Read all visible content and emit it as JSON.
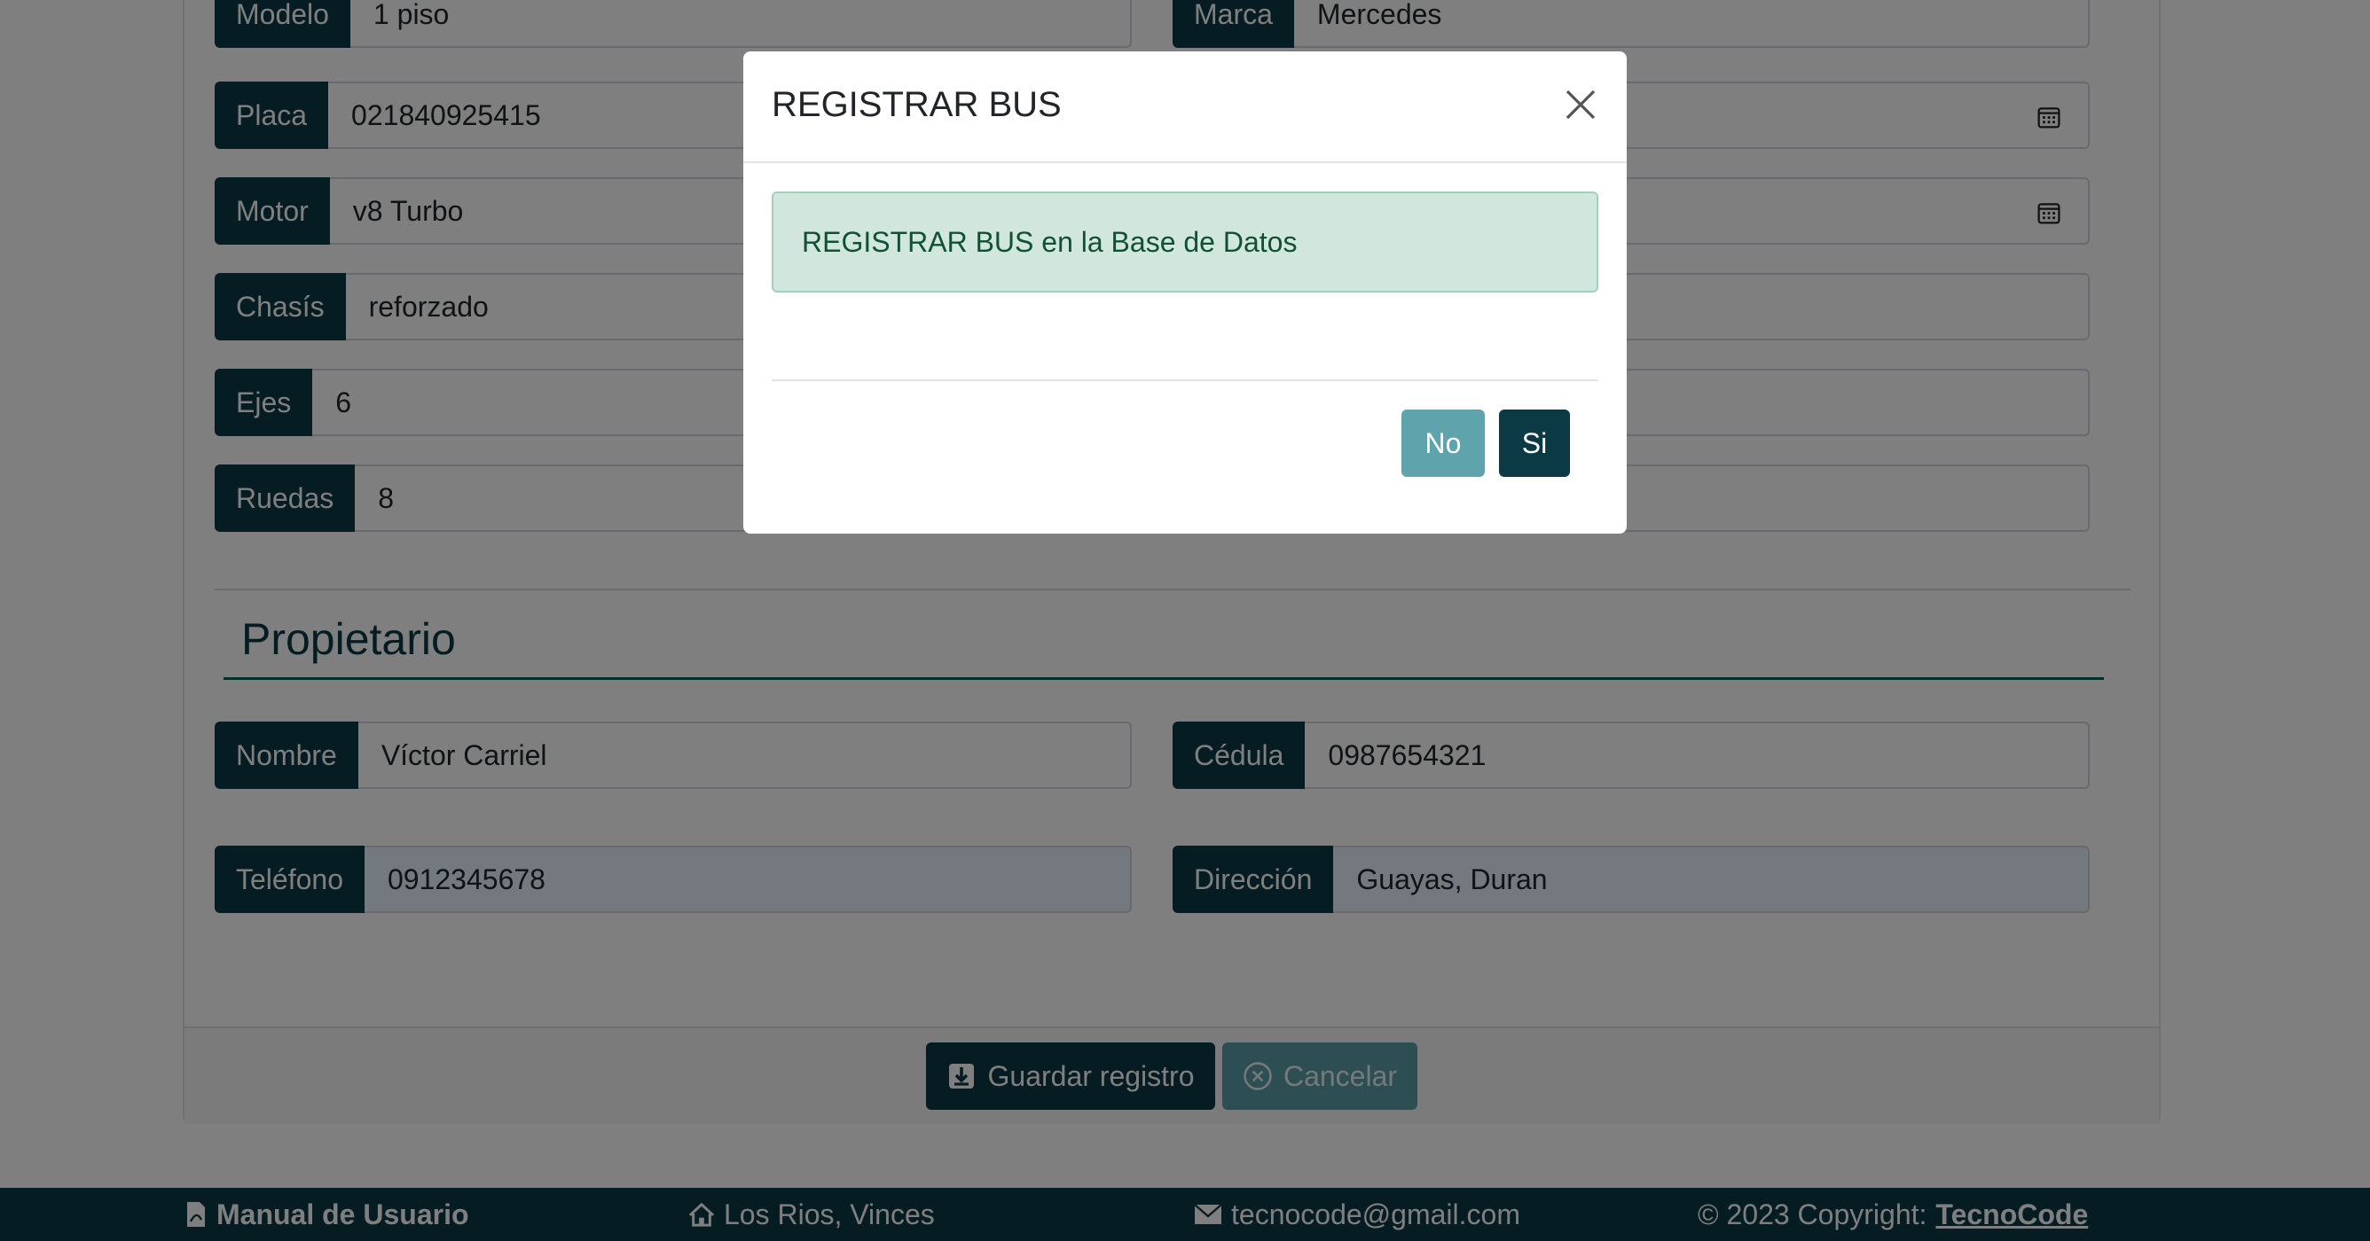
{
  "form": {
    "fields": {
      "modelo": {
        "label": "Modelo",
        "value": "1 piso"
      },
      "marca": {
        "label": "Marca",
        "value": "Mercedes"
      },
      "placa": {
        "label": "Placa",
        "value": "021840925415"
      },
      "motor": {
        "label": "Motor",
        "value": "v8 Turbo"
      },
      "chasis": {
        "label": "Chasís",
        "value": "reforzado"
      },
      "ejes": {
        "label": "Ejes",
        "value": "6"
      },
      "ruedas": {
        "label": "Ruedas",
        "value": "8"
      }
    },
    "owner_section_title": "Propietario",
    "owner": {
      "nombre": {
        "label": "Nombre",
        "value": "Víctor Carriel"
      },
      "cedula": {
        "label": "Cédula",
        "value": "0987654321"
      },
      "telefono": {
        "label": "Teléfono",
        "value": "0912345678"
      },
      "direccion": {
        "label": "Dirección",
        "value": "Guayas, Duran"
      }
    },
    "save_label": "Guardar registro",
    "cancel_label": "Cancelar"
  },
  "footer": {
    "manual": "Manual de Usuario",
    "location": "Los Rios, Vinces",
    "email": "tecnocode@gmail.com",
    "copyright_prefix": "© 2023 Copyright:",
    "brand": "TecnoCode"
  },
  "modal": {
    "title": "REGISTRAR BUS",
    "message": "REGISTRAR BUS en la Base de Datos",
    "no_label": "No",
    "yes_label": "Si"
  },
  "icons": {
    "calendar": "calendar-icon",
    "close": "close-icon",
    "save": "download-icon",
    "cancel": "x-circle-icon",
    "pdf": "file-pdf-icon",
    "home": "house-icon",
    "email": "envelope-icon"
  },
  "colors": {
    "primary": "#0b3a45",
    "secondary": "#5fa3ad",
    "success_bg": "#d1e7dd",
    "success_text": "#0f5132"
  }
}
